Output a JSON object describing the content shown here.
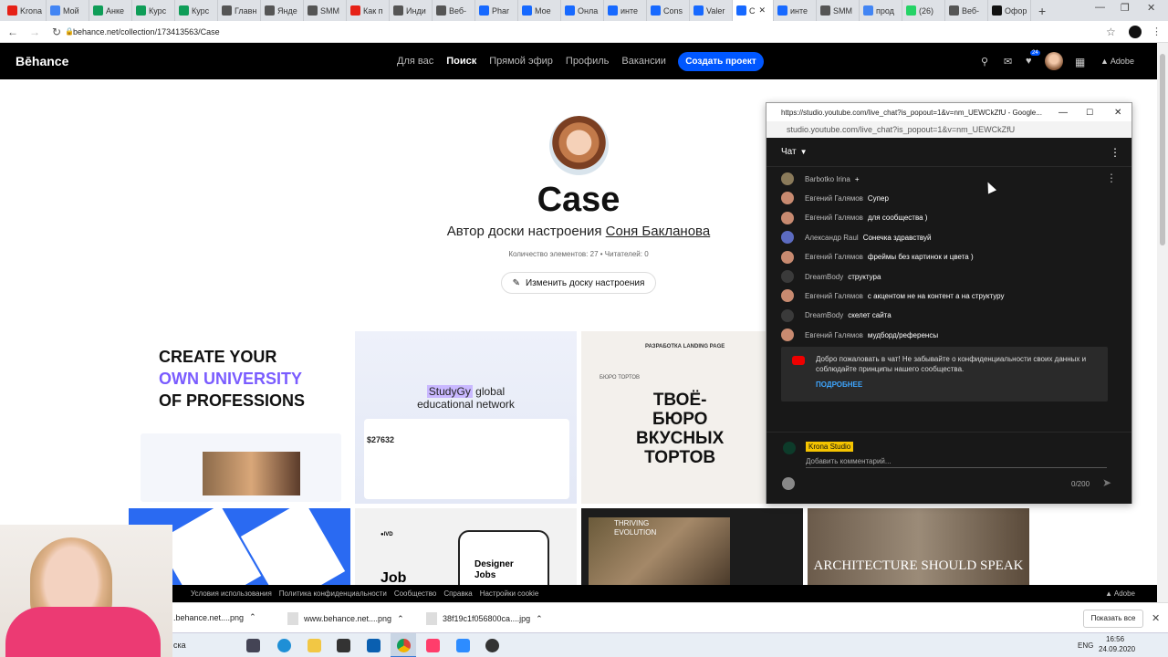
{
  "tabs": [
    {
      "label": "Krona",
      "color": "#e62117"
    },
    {
      "label": "Мой",
      "color": "#4285f4"
    },
    {
      "label": "Анке",
      "color": "#0f9d58"
    },
    {
      "label": "Курс",
      "color": "#0f9d58"
    },
    {
      "label": "Курс",
      "color": "#0f9d58"
    },
    {
      "label": "Главн",
      "color": "#555555"
    },
    {
      "label": "Янде",
      "color": "#555555"
    },
    {
      "label": "SMM",
      "color": "#555555"
    },
    {
      "label": "Как п",
      "color": "#e62117"
    },
    {
      "label": "Инди",
      "color": "#555555"
    },
    {
      "label": "Веб-",
      "color": "#555555"
    },
    {
      "label": "Phar",
      "color": "#1769ff"
    },
    {
      "label": "Мое",
      "color": "#1769ff"
    },
    {
      "label": "Онла",
      "color": "#1769ff"
    },
    {
      "label": "инте",
      "color": "#1769ff"
    },
    {
      "label": "Cons",
      "color": "#1769ff"
    },
    {
      "label": "Valer",
      "color": "#1769ff"
    },
    {
      "label": "C",
      "color": "#1769ff",
      "active": true
    },
    {
      "label": "инте",
      "color": "#1769ff"
    },
    {
      "label": "SMM",
      "color": "#555555"
    },
    {
      "label": "прод",
      "color": "#4285f4"
    },
    {
      "label": "(26)",
      "color": "#25d366"
    },
    {
      "label": "Веб-",
      "color": "#555555"
    },
    {
      "label": "Офор",
      "color": "#111111"
    }
  ],
  "address": {
    "url": "behance.net/collection/173413563/Case"
  },
  "behance": {
    "logo": "Bēhance",
    "nav": [
      "Для вас",
      "Поиск",
      "Прямой эфир",
      "Профиль",
      "Вакансии"
    ],
    "create_button": "Создать проект",
    "notif_count": "24",
    "adobe": "Adobe"
  },
  "moodboard": {
    "title": "Case",
    "author_prefix": "Автор доски настроения",
    "author_name": "Соня Бакланова",
    "counts": "Количество элементов: 27 • Читателей: 0",
    "edit_button": "Изменить доску настроения"
  },
  "cards": {
    "c1": {
      "line1": "CREATE YOUR",
      "line2": "OWN UNIVERSITY",
      "line3": "OF PROFESSIONS"
    },
    "c2": {
      "title_hl": "StudyGy",
      "title_rest": "global",
      "subtitle": "educational network",
      "price": "$27632"
    },
    "c3": {
      "header": "РАЗРАБОТКА LANDING PAGE",
      "line1": "ТВОЁ-",
      "line2": "БЮРО",
      "line3": "ВКУСНЫХ",
      "line4": "ТОРТОВ",
      "small": "БЮРО ТОРТОВ"
    },
    "c6": {
      "title": "Designer Jobs",
      "brand": "Job"
    },
    "c7": {
      "title": "THRIVING EVOLUTION"
    },
    "c8": {
      "title": "ARCHITECTURE SHOULD SPEAK"
    }
  },
  "footer": {
    "links": [
      "Условия использования",
      "Политика конфиденциальности",
      "Сообщество",
      "Справка",
      "Настройки cookie"
    ],
    "adobe": "Adobe"
  },
  "chat_window": {
    "title": "https://studio.youtube.com/live_chat?is_popout=1&v=nm_UEWCkZfU - Google...",
    "url": "studio.youtube.com/live_chat?is_popout=1&v=nm_UEWCkZfU",
    "header": "Чат",
    "messages": [
      {
        "author": "Barbotko Irina",
        "text": "+",
        "color": "#8a7a5a"
      },
      {
        "author": "Евгений Галямов",
        "text": "Супер",
        "color": "#c88a70"
      },
      {
        "author": "Евгений Галямов",
        "text": "для сообщества )",
        "color": "#c88a70"
      },
      {
        "author": "Александр Raul",
        "text": "Сонечка здравствуй",
        "color": "#5c6bc0"
      },
      {
        "author": "Евгений Галямов",
        "text": "фреймы без картинок и цвета )",
        "color": "#c88a70"
      },
      {
        "author": "DreamBody",
        "text": "структура",
        "color": "#3a3a3a"
      },
      {
        "author": "Евгений Галямов",
        "text": "с акцентом не на контент а на структуру",
        "color": "#c88a70"
      },
      {
        "author": "DreamBody",
        "text": "скелет сайта",
        "color": "#3a3a3a"
      },
      {
        "author": "Евгений Галямов",
        "text": "мудборд/референсы",
        "color": "#c88a70"
      }
    ],
    "welcome": "Добро пожаловать в чат! Не забывайте о конфиденциальности своих данных и соблюдайте принципы нашего сообщества.",
    "learn_more": "ПОДРОБНЕЕ",
    "channel_name": "Krona Studio",
    "input_placeholder": "Добавить комментарий...",
    "char_count": "0/200"
  },
  "downloads": {
    "items": [
      ".behance.net....png",
      "www.behance.net....png",
      "38f19c1f056800ca....jpg"
    ],
    "show_all": "Показать все"
  },
  "taskbar": {
    "search_text": "ска",
    "lang": "ENG",
    "time": "16:56",
    "date": "24.09.2020"
  }
}
